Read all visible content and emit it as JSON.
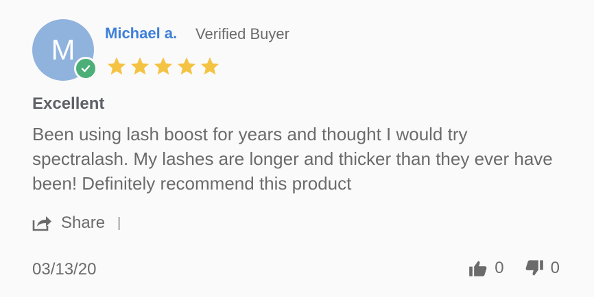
{
  "reviewer": {
    "initial": "M",
    "name": "Michael a.",
    "badge": "Verified Buyer",
    "avatar_color": "#8fb3dd",
    "verified_color": "#4caf78"
  },
  "rating": {
    "value": 5,
    "max": 5,
    "star_color": "#f5c343"
  },
  "review": {
    "title": "Excellent",
    "body": "Been using lash boost for years and thought I would try spectralash. My lashes are longer and thicker than they ever have been! Definitely recommend this product"
  },
  "actions": {
    "share_label": "Share",
    "divider": "|",
    "share_icon": "share-icon"
  },
  "meta": {
    "date": "03/13/20",
    "upvotes": "0",
    "downvotes": "0",
    "upvote_icon": "thumbs-up-icon",
    "downvote_icon": "thumbs-down-icon"
  }
}
